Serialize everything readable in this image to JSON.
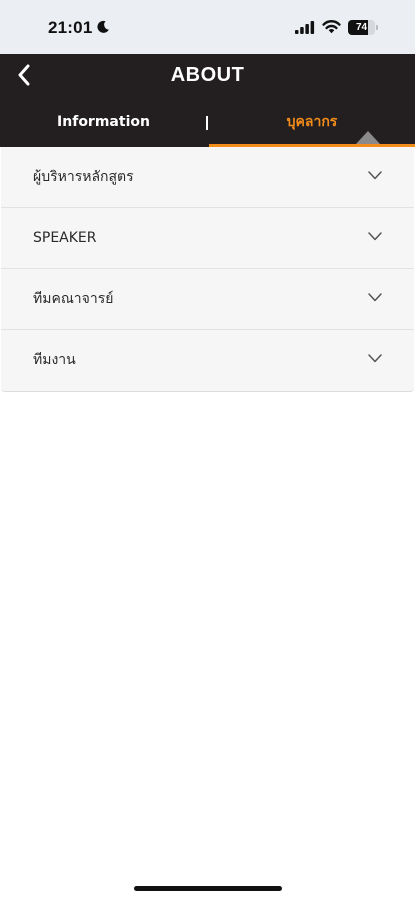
{
  "status_bar": {
    "time": "21:01",
    "battery_level": "74",
    "battery_fraction": 0.74
  },
  "header": {
    "title": "ABOUT",
    "tabs": [
      {
        "label": "Information",
        "active": false
      },
      {
        "label": "บุคลากร",
        "active": true
      }
    ]
  },
  "list": {
    "items": [
      {
        "label": "ผู้บริหารหลักสูตร"
      },
      {
        "label": "SPEAKER"
      },
      {
        "label": "ทีมคณาจารย์"
      },
      {
        "label": "ทีมงาน"
      }
    ]
  },
  "colors": {
    "header_bg": "#231f20",
    "accent": "#f28c1a",
    "list_bg": "#f6f6f6",
    "status_bg": "#ebeef2"
  },
  "icons": [
    "moon-icon",
    "signal-icon",
    "wifi-icon",
    "battery-icon",
    "back-arrow-icon",
    "chevron-down-icon"
  ]
}
